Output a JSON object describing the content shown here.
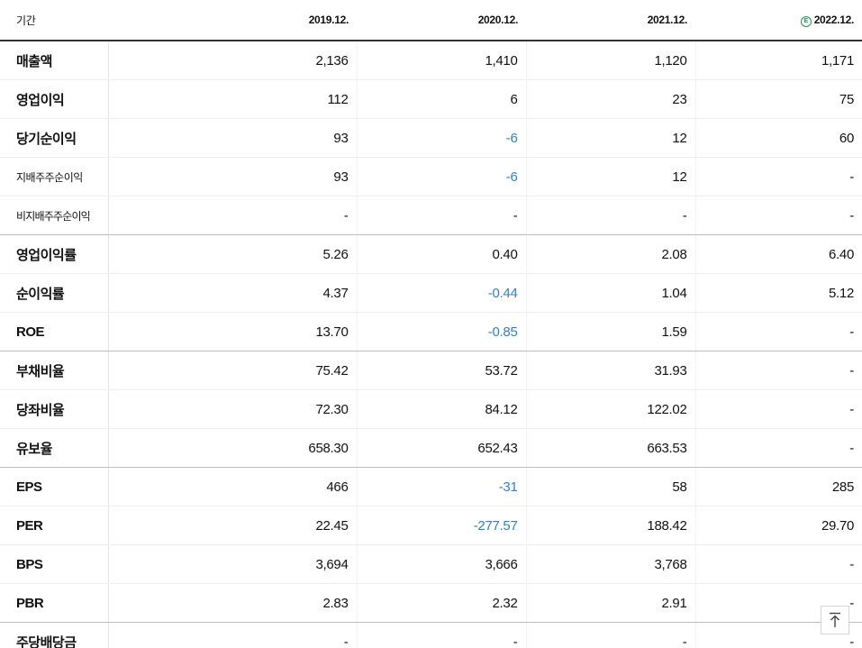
{
  "header": {
    "period_label": "기간",
    "years": [
      "2019.12.",
      "2020.12.",
      "2021.12.",
      "2022.12."
    ],
    "estimate_mark": "E"
  },
  "rows": [
    {
      "label": "매출액",
      "values": [
        "2,136",
        "1,410",
        "1,120",
        "1,171"
      ]
    },
    {
      "label": "영업이익",
      "values": [
        "112",
        "6",
        "23",
        "75"
      ]
    },
    {
      "label": "당기순이익",
      "values": [
        "93",
        "-6",
        "12",
        "60"
      ]
    },
    {
      "label": "지배주주순이익",
      "values": [
        "93",
        "-6",
        "12",
        "-"
      ]
    },
    {
      "label": "비지배주주순이익",
      "values": [
        "-",
        "-",
        "-",
        "-"
      ]
    },
    {
      "label": "영업이익률",
      "values": [
        "5.26",
        "0.40",
        "2.08",
        "6.40"
      ]
    },
    {
      "label": "순이익률",
      "values": [
        "4.37",
        "-0.44",
        "1.04",
        "5.12"
      ]
    },
    {
      "label": "ROE",
      "values": [
        "13.70",
        "-0.85",
        "1.59",
        "-"
      ]
    },
    {
      "label": "부채비율",
      "values": [
        "75.42",
        "53.72",
        "31.93",
        "-"
      ]
    },
    {
      "label": "당좌비율",
      "values": [
        "72.30",
        "84.12",
        "122.02",
        "-"
      ]
    },
    {
      "label": "유보율",
      "values": [
        "658.30",
        "652.43",
        "663.53",
        "-"
      ]
    },
    {
      "label": "EPS",
      "values": [
        "466",
        "-31",
        "58",
        "285"
      ]
    },
    {
      "label": "PER",
      "values": [
        "22.45",
        "-277.57",
        "188.42",
        "29.70"
      ]
    },
    {
      "label": "BPS",
      "values": [
        "3,694",
        "3,666",
        "3,768",
        "-"
      ]
    },
    {
      "label": "PBR",
      "values": [
        "2.83",
        "2.32",
        "2.91",
        "-"
      ]
    },
    {
      "label": "주당배당금",
      "values": [
        "-",
        "-",
        "-",
        "-"
      ]
    }
  ],
  "colors": {
    "negative": "#2d7fd1",
    "estimate": "#1a9a4a"
  },
  "icons": {
    "scroll_top": "arrow-up-to-line-icon"
  }
}
